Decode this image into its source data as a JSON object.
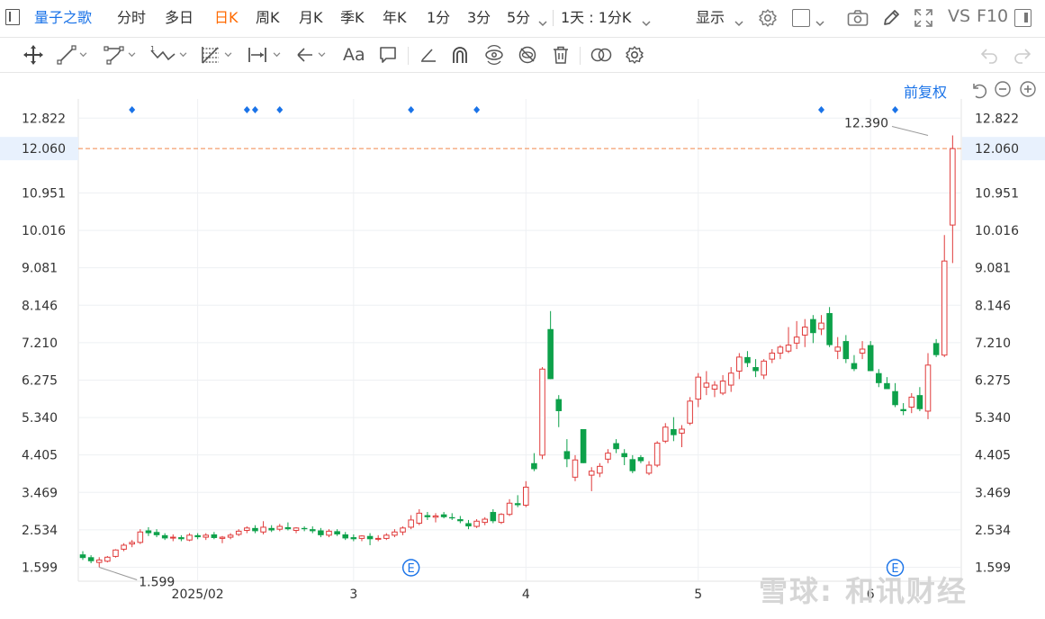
{
  "header": {
    "stock_name": "量子之歌",
    "periods": [
      "分时",
      "多日",
      "日K",
      "周K",
      "月K",
      "季K",
      "年K",
      "1分",
      "3分",
      "5分"
    ],
    "active_period": "日K",
    "combo_period": "1天 : 1分K",
    "display_label": "显示",
    "vs_label": "VS",
    "f10_label": "F10"
  },
  "toolbar": {
    "icons": [
      "move-icon",
      "line-segment-icon",
      "polyline-icon",
      "wave-icon",
      "fibonacci-icon",
      "range-icon",
      "arrow-icon",
      "text-icon",
      "comment-icon",
      "pen-icon",
      "magnet-icon",
      "eye-cycle-icon",
      "hide-icon",
      "trash-icon",
      "link-icon",
      "settings-icon",
      "undo-icon",
      "redo-icon"
    ],
    "text_tool_label": "Aa"
  },
  "chart_controls": {
    "adjust_label": "前复权"
  },
  "colors": {
    "up": "#e03b3b",
    "down": "#0da14a",
    "crosshair": "#f2884b",
    "marker": "#1a73e8",
    "grid": "#eef0f3"
  },
  "chart_data": {
    "type": "candlestick",
    "x": [
      "2025-01-14",
      "2025-01-15",
      "2025-01-16",
      "2025-01-17",
      "2025-01-20",
      "2025-01-21",
      "2025-01-22",
      "2025-01-23",
      "2025-01-24",
      "2025-01-27",
      "2025-01-28",
      "2025-01-29",
      "2025-01-30",
      "2025-01-31",
      "2025-02-03",
      "2025-02-04",
      "2025-02-05",
      "2025-02-06",
      "2025-02-07",
      "2025-02-10",
      "2025-02-11",
      "2025-02-12",
      "2025-02-13",
      "2025-02-14",
      "2025-02-18",
      "2025-02-19",
      "2025-02-20",
      "2025-02-21",
      "2025-02-24",
      "2025-02-25",
      "2025-02-26",
      "2025-02-27",
      "2025-02-28",
      "2025-03-03",
      "2025-03-04",
      "2025-03-05",
      "2025-03-06",
      "2025-03-07",
      "2025-03-10",
      "2025-03-11",
      "2025-03-12",
      "2025-03-13",
      "2025-03-14",
      "2025-03-17",
      "2025-03-18",
      "2025-03-19",
      "2025-03-20",
      "2025-03-21",
      "2025-03-24",
      "2025-03-25",
      "2025-03-26",
      "2025-03-27",
      "2025-03-28",
      "2025-03-31",
      "2025-04-01",
      "2025-04-02",
      "2025-04-03",
      "2025-04-04",
      "2025-04-07",
      "2025-04-08",
      "2025-04-09",
      "2025-04-10",
      "2025-04-11",
      "2025-04-14",
      "2025-04-15",
      "2025-04-16",
      "2025-04-17",
      "2025-04-21",
      "2025-04-22",
      "2025-04-23",
      "2025-04-24",
      "2025-04-25",
      "2025-04-28",
      "2025-04-29",
      "2025-04-30",
      "2025-05-01",
      "2025-05-02",
      "2025-05-05",
      "2025-05-06",
      "2025-05-07",
      "2025-05-08",
      "2025-05-09",
      "2025-05-12",
      "2025-05-13",
      "2025-05-14",
      "2025-05-15",
      "2025-05-16",
      "2025-05-19",
      "2025-05-20",
      "2025-05-21",
      "2025-05-22",
      "2025-05-23",
      "2025-05-27",
      "2025-05-28",
      "2025-05-29",
      "2025-05-30",
      "2025-06-02",
      "2025-06-03",
      "2025-06-04",
      "2025-06-05",
      "2025-06-06",
      "2025-06-09",
      "2025-06-10",
      "2025-06-11"
    ],
    "ohlc": [
      [
        1.92,
        2.0,
        1.78,
        1.83
      ],
      [
        1.85,
        1.9,
        1.7,
        1.75
      ],
      [
        1.72,
        1.85,
        1.6,
        1.78
      ],
      [
        1.75,
        1.88,
        1.72,
        1.85
      ],
      [
        1.87,
        2.05,
        1.84,
        2.03
      ],
      [
        2.05,
        2.2,
        2.0,
        2.15
      ],
      [
        2.18,
        2.28,
        2.1,
        2.22
      ],
      [
        2.22,
        2.55,
        2.18,
        2.48
      ],
      [
        2.52,
        2.6,
        2.38,
        2.45
      ],
      [
        2.48,
        2.55,
        2.35,
        2.4
      ],
      [
        2.4,
        2.45,
        2.28,
        2.32
      ],
      [
        2.33,
        2.42,
        2.25,
        2.35
      ],
      [
        2.35,
        2.4,
        2.25,
        2.3
      ],
      [
        2.28,
        2.45,
        2.25,
        2.4
      ],
      [
        2.4,
        2.45,
        2.3,
        2.35
      ],
      [
        2.35,
        2.45,
        2.28,
        2.4
      ],
      [
        2.42,
        2.48,
        2.3,
        2.33
      ],
      [
        2.32,
        2.38,
        2.2,
        2.35
      ],
      [
        2.35,
        2.45,
        2.3,
        2.4
      ],
      [
        2.42,
        2.55,
        2.38,
        2.5
      ],
      [
        2.52,
        2.62,
        2.45,
        2.58
      ],
      [
        2.58,
        2.65,
        2.45,
        2.5
      ],
      [
        2.48,
        2.75,
        2.42,
        2.6
      ],
      [
        2.58,
        2.65,
        2.48,
        2.52
      ],
      [
        2.55,
        2.68,
        2.5,
        2.62
      ],
      [
        2.6,
        2.72,
        2.52,
        2.55
      ],
      [
        2.52,
        2.6,
        2.45,
        2.58
      ],
      [
        2.58,
        2.62,
        2.5,
        2.55
      ],
      [
        2.55,
        2.62,
        2.45,
        2.5
      ],
      [
        2.52,
        2.58,
        2.35,
        2.4
      ],
      [
        2.4,
        2.55,
        2.35,
        2.5
      ],
      [
        2.5,
        2.55,
        2.38,
        2.42
      ],
      [
        2.42,
        2.48,
        2.28,
        2.32
      ],
      [
        2.35,
        2.42,
        2.25,
        2.3
      ],
      [
        2.32,
        2.4,
        2.25,
        2.38
      ],
      [
        2.38,
        2.45,
        2.15,
        2.3
      ],
      [
        2.3,
        2.4,
        2.25,
        2.32
      ],
      [
        2.32,
        2.45,
        2.28,
        2.4
      ],
      [
        2.4,
        2.55,
        2.35,
        2.48
      ],
      [
        2.48,
        2.62,
        2.4,
        2.58
      ],
      [
        2.6,
        2.9,
        2.55,
        2.78
      ],
      [
        2.7,
        3.05,
        2.65,
        2.95
      ],
      [
        2.9,
        2.98,
        2.78,
        2.85
      ],
      [
        2.85,
        2.95,
        2.72,
        2.88
      ],
      [
        2.92,
        2.98,
        2.82,
        2.85
      ],
      [
        2.85,
        2.95,
        2.78,
        2.82
      ],
      [
        2.8,
        2.88,
        2.7,
        2.75
      ],
      [
        2.7,
        2.78,
        2.55,
        2.62
      ],
      [
        2.62,
        2.8,
        2.58,
        2.75
      ],
      [
        2.72,
        2.85,
        2.65,
        2.8
      ],
      [
        2.98,
        3.05,
        2.7,
        2.75
      ],
      [
        2.72,
        2.95,
        2.68,
        2.92
      ],
      [
        2.92,
        3.3,
        2.88,
        3.2
      ],
      [
        3.2,
        3.4,
        3.1,
        3.15
      ],
      [
        3.15,
        3.75,
        3.1,
        3.6
      ],
      [
        4.2,
        4.45,
        4.0,
        4.05
      ],
      [
        4.4,
        6.6,
        4.3,
        6.55
      ],
      [
        7.55,
        8.0,
        6.3,
        6.3
      ],
      [
        5.8,
        5.9,
        5.1,
        5.5
      ],
      [
        4.5,
        4.8,
        4.1,
        4.3
      ],
      [
        3.85,
        4.4,
        3.75,
        4.28
      ],
      [
        5.05,
        5.05,
        4.2,
        4.2
      ],
      [
        3.9,
        4.1,
        3.5,
        4.0
      ],
      [
        3.95,
        4.2,
        3.85,
        4.12
      ],
      [
        4.3,
        4.55,
        4.2,
        4.45
      ],
      [
        4.7,
        4.8,
        4.45,
        4.55
      ],
      [
        4.45,
        4.55,
        4.15,
        4.35
      ],
      [
        4.3,
        4.4,
        3.95,
        4.0
      ],
      [
        4.35,
        4.4,
        4.2,
        4.25
      ],
      [
        3.95,
        4.25,
        3.9,
        4.15
      ],
      [
        4.15,
        4.75,
        4.1,
        4.7
      ],
      [
        4.75,
        5.2,
        4.7,
        5.1
      ],
      [
        5.05,
        5.35,
        4.75,
        4.9
      ],
      [
        4.95,
        5.15,
        4.6,
        5.05
      ],
      [
        5.2,
        5.85,
        5.15,
        5.75
      ],
      [
        5.8,
        6.45,
        5.6,
        6.35
      ],
      [
        6.1,
        6.5,
        5.9,
        6.2
      ],
      [
        6.05,
        6.25,
        5.85,
        6.15
      ],
      [
        5.95,
        6.4,
        5.9,
        6.25
      ],
      [
        6.15,
        6.6,
        5.98,
        6.45
      ],
      [
        6.5,
        6.95,
        6.3,
        6.85
      ],
      [
        6.85,
        7.0,
        6.6,
        6.7
      ],
      [
        6.6,
        6.8,
        6.35,
        6.5
      ],
      [
        6.4,
        6.8,
        6.3,
        6.75
      ],
      [
        6.8,
        7.05,
        6.7,
        6.95
      ],
      [
        6.95,
        7.15,
        6.8,
        7.1
      ],
      [
        7.0,
        7.6,
        6.95,
        7.15
      ],
      [
        7.2,
        7.75,
        7.05,
        7.35
      ],
      [
        7.4,
        7.8,
        7.1,
        7.6
      ],
      [
        7.8,
        7.9,
        7.2,
        7.45
      ],
      [
        7.55,
        7.9,
        7.4,
        7.7
      ],
      [
        7.95,
        8.1,
        7.1,
        7.15
      ],
      [
        7.0,
        7.35,
        6.8,
        7.1
      ],
      [
        7.25,
        7.4,
        6.7,
        6.8
      ],
      [
        6.7,
        6.9,
        6.5,
        6.55
      ],
      [
        6.95,
        7.25,
        6.8,
        7.05
      ],
      [
        7.15,
        7.25,
        6.5,
        6.5
      ],
      [
        6.45,
        6.55,
        6.1,
        6.2
      ],
      [
        6.2,
        6.35,
        6.05,
        6.05
      ],
      [
        6.0,
        6.2,
        5.6,
        5.65
      ],
      [
        5.55,
        5.7,
        5.4,
        5.5
      ],
      [
        5.6,
        5.95,
        5.45,
        5.85
      ],
      [
        5.9,
        6.1,
        5.5,
        5.55
      ],
      [
        5.5,
        6.95,
        5.3,
        6.65
      ],
      [
        7.2,
        7.3,
        6.85,
        6.9
      ],
      [
        6.9,
        9.9,
        6.85,
        9.25
      ],
      [
        10.15,
        12.39,
        9.2,
        12.06
      ]
    ],
    "y_ticks": [
      12.822,
      12.06,
      10.951,
      10.016,
      9.081,
      8.146,
      7.21,
      6.275,
      5.34,
      4.405,
      3.469,
      2.534,
      1.599
    ],
    "ylim": [
      1.25,
      13.3
    ],
    "x_ticks": [
      {
        "date": "2025-02-03",
        "label": "2025/02"
      },
      {
        "date": "2025-03-03",
        "label": "3"
      },
      {
        "date": "2025-04-01",
        "label": "4"
      },
      {
        "date": "2025-05-01",
        "label": "5"
      },
      {
        "date": "2025-06-02",
        "label": "6"
      }
    ],
    "crosshair_value": 12.06,
    "crosshair_label": "12.060",
    "max_label": "12.390",
    "min_label": "1.599",
    "max_value": 12.39,
    "min_value": 1.599,
    "max_date": "2025-06-11",
    "min_date": "2025-01-16",
    "event_markers": [
      "2025-01-22",
      "2025-02-11",
      "2025-02-12",
      "2025-02-18",
      "2025-03-12",
      "2025-03-24",
      "2025-05-22",
      "2025-06-05"
    ],
    "earnings_markers": [
      "2025-03-12",
      "2025-06-05"
    ],
    "earnings_label": "E"
  },
  "watermark": "雪球: 和讯财经"
}
